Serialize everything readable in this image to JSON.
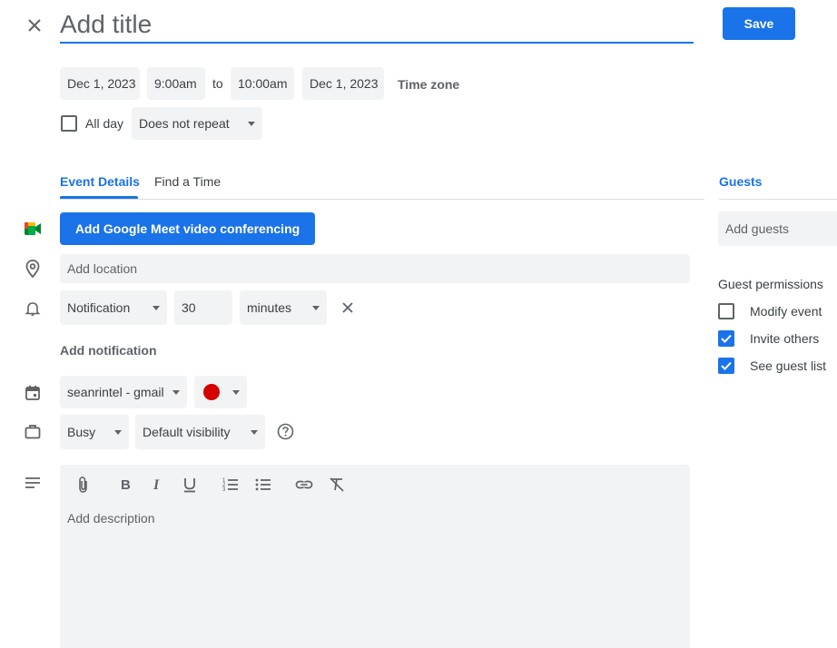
{
  "header": {
    "title_placeholder": "Add title",
    "save_label": "Save"
  },
  "datetime": {
    "start_date": "Dec 1, 2023",
    "start_time": "9:00am",
    "to_label": "to",
    "end_time": "10:00am",
    "end_date": "Dec 1, 2023",
    "timezone_label": "Time zone",
    "allday_label": "All day",
    "repeat_value": "Does not repeat"
  },
  "tabs": {
    "event_details": "Event Details",
    "find_time": "Find a Time",
    "guests": "Guests"
  },
  "details": {
    "meet_button": "Add Google Meet video conferencing",
    "location_placeholder": "Add location",
    "notification_type": "Notification",
    "notification_value": "30",
    "notification_unit": "minutes",
    "add_notification": "Add notification",
    "calendar_name": "seanrintel - gmail",
    "event_color": "#d50000",
    "busy_value": "Busy",
    "visibility_value": "Default visibility",
    "description_placeholder": "Add description"
  },
  "guests": {
    "add_placeholder": "Add guests",
    "permissions_title": "Guest permissions",
    "permissions": [
      {
        "label": "Modify event",
        "checked": false
      },
      {
        "label": "Invite others",
        "checked": true
      },
      {
        "label": "See guest list",
        "checked": true
      }
    ]
  },
  "colors": {
    "accent": "#1a73e8",
    "field_bg": "#f1f3f4"
  }
}
